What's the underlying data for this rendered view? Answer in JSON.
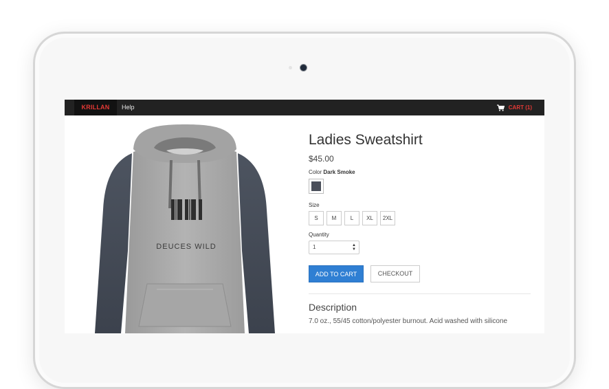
{
  "navbar": {
    "brand": "KRILLAN",
    "help": "Help",
    "cart_label": "CART (1)"
  },
  "product": {
    "title": "Ladies Sweatshirt",
    "price": "$45.00",
    "image_text": "DEUCES WILD",
    "color_label": "Color",
    "color_value": "Dark Smoke",
    "swatch_color": "#4a4f5a",
    "size_label": "Size",
    "sizes": [
      "S",
      "M",
      "L",
      "XL",
      "2XL"
    ],
    "quantity_label": "Quantity",
    "quantity_value": "1",
    "add_to_cart": "ADD TO CART",
    "checkout": "CHECKOUT",
    "description_title": "Description",
    "description_text": "7.0 oz., 55/45 cotton/polyester burnout. Acid washed with silicone"
  },
  "colors": {
    "navbar_bg": "#222222",
    "brand_red": "#e53935",
    "primary_button": "#2f7fd3"
  }
}
